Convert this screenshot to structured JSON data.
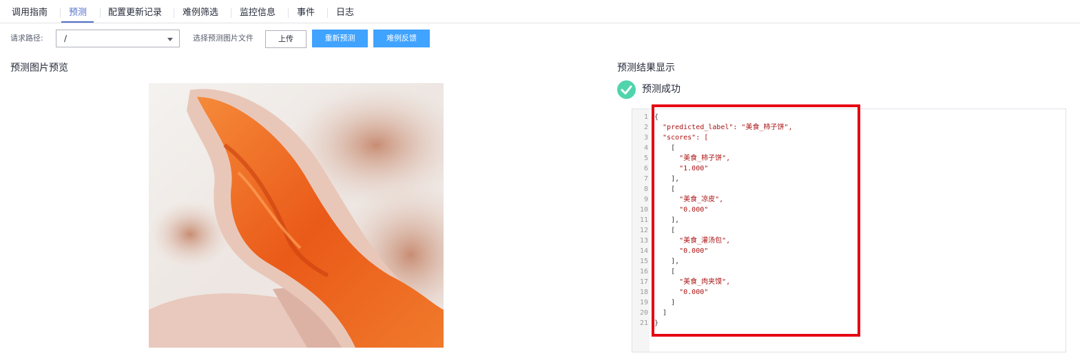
{
  "tabs": [
    {
      "label": "调用指南"
    },
    {
      "label": "预测"
    },
    {
      "label": "配置更新记录"
    },
    {
      "label": "难例筛选"
    },
    {
      "label": "监控信息"
    },
    {
      "label": "事件"
    },
    {
      "label": "日志"
    }
  ],
  "toolbar": {
    "path_label": "请求路径:",
    "path_value": "/",
    "file_label": "选择预测图片文件",
    "upload_button": "上传",
    "repredict_button": "重新预测",
    "feedback_button": "难例反馈"
  },
  "left_panel": {
    "title": "预测图片预览"
  },
  "right_panel": {
    "title": "预测结果显示",
    "status_text": "预测成功"
  },
  "code": {
    "line_numbers": [
      "1",
      "2",
      "3",
      "4",
      "5",
      "6",
      "7",
      "8",
      "9",
      "10",
      "11",
      "12",
      "13",
      "14",
      "15",
      "16",
      "17",
      "18",
      "19",
      "20",
      "21"
    ],
    "lines": [
      "{",
      "  \"predicted_label\": \"美食_柿子饼\",",
      "  \"scores\": [",
      "    [",
      "      \"美食_柿子饼\",",
      "      \"1.000\"",
      "    ],",
      "    [",
      "      \"美食_凉皮\",",
      "      \"0.000\"",
      "    ],",
      "    [",
      "      \"美食_灌汤包\",",
      "      \"0.000\"",
      "    ],",
      "    [",
      "      \"美食_肉夹馍\",",
      "      \"0.000\"",
      "    ]",
      "  ]",
      "}"
    ]
  },
  "colors": {
    "accent": "#526ecc",
    "primary_button": "#3fa3ff",
    "success": "#50d4ab",
    "highlight": "#e60012"
  }
}
